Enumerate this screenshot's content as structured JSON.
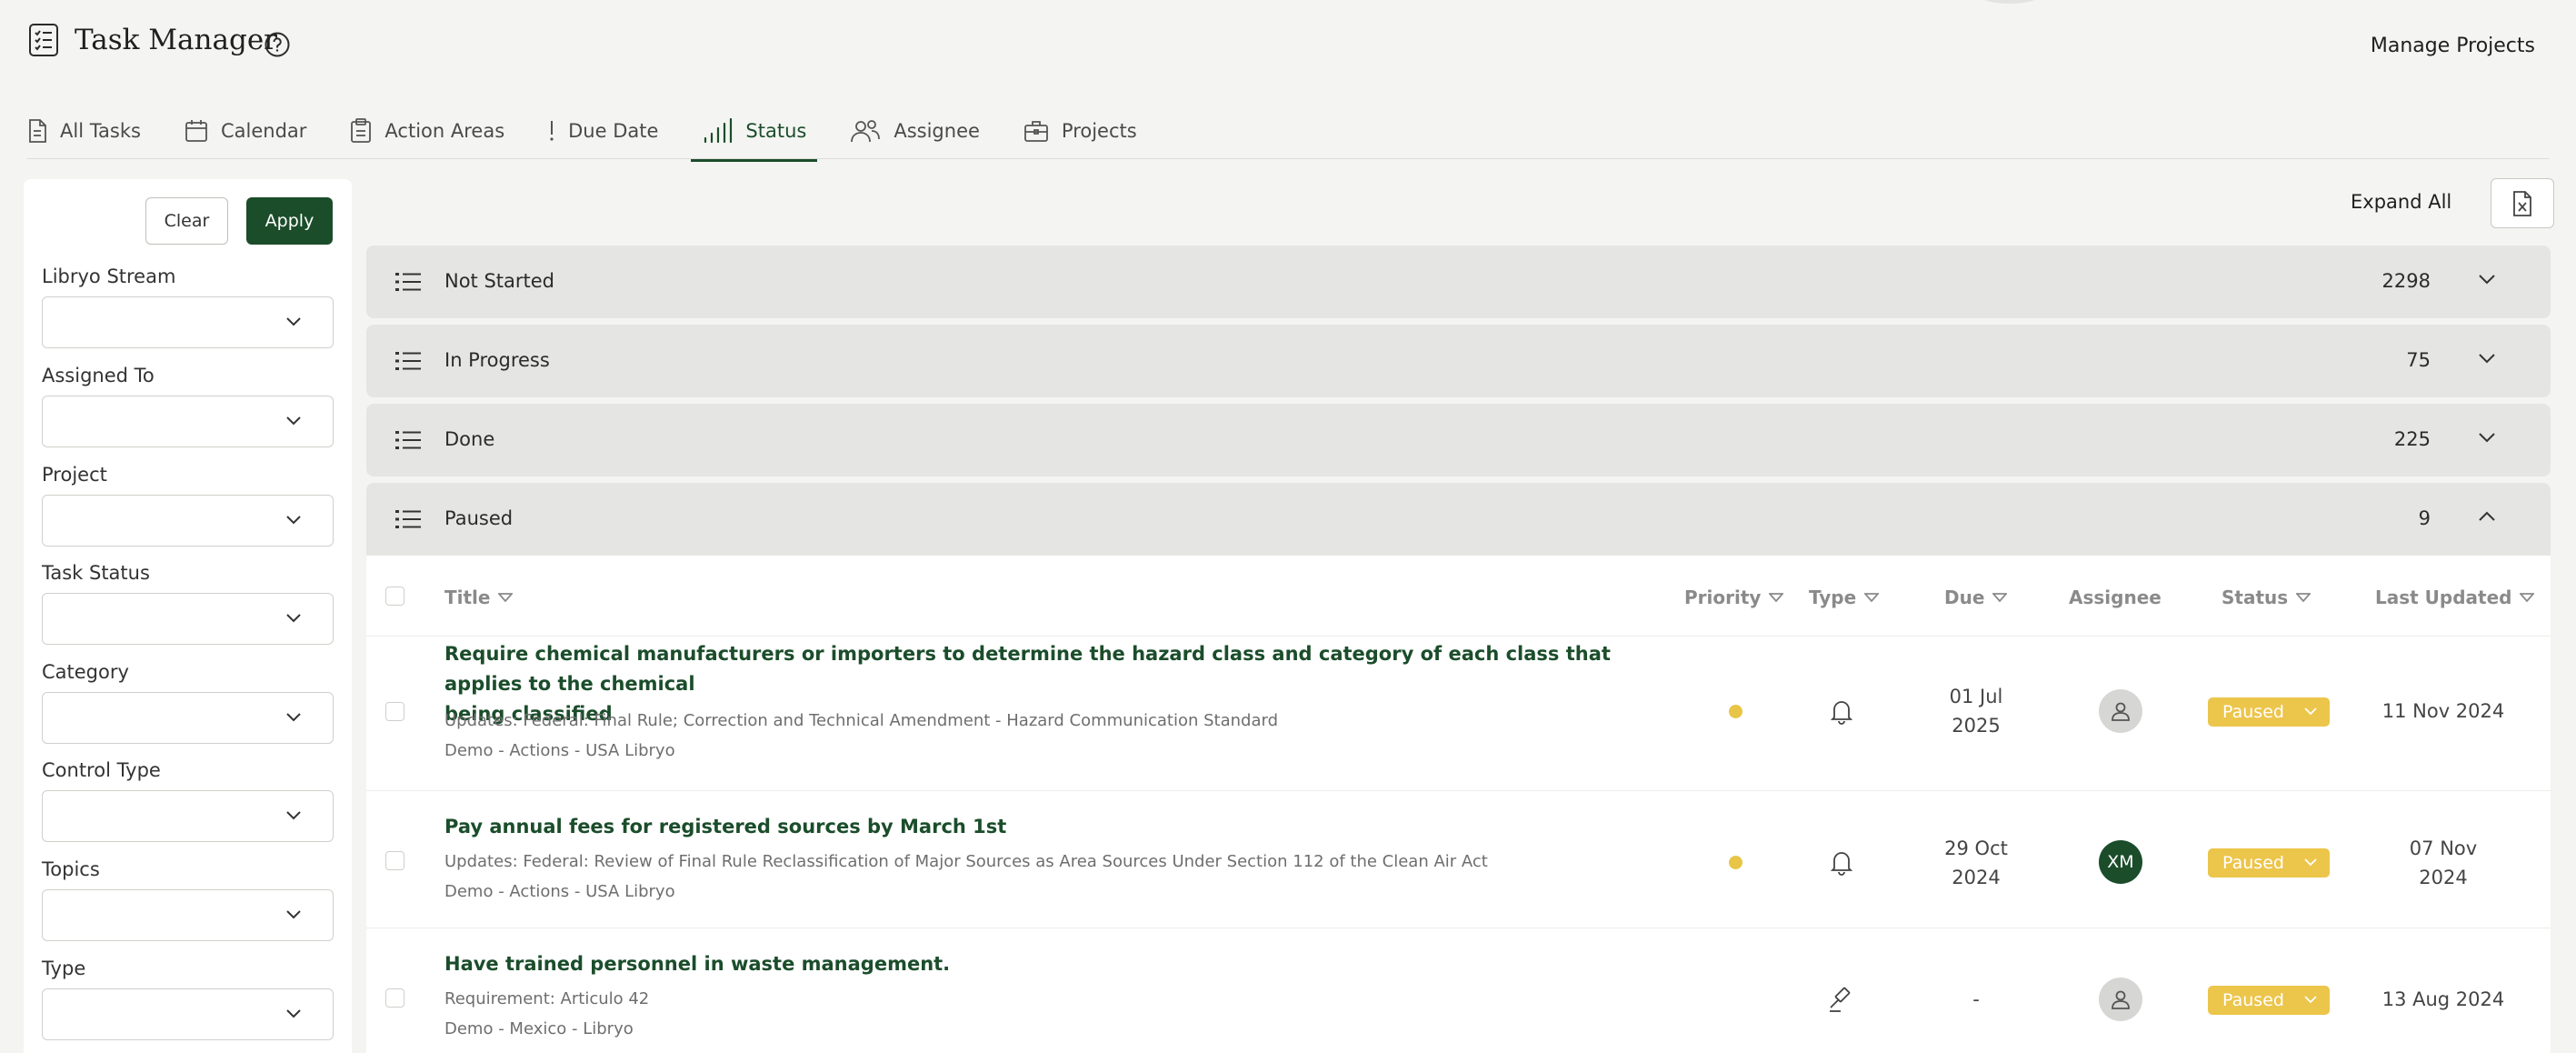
{
  "header": {
    "title": "Task Manager",
    "manage_projects": "Manage Projects"
  },
  "tabs": [
    {
      "label": "All Tasks",
      "icon": "document-icon"
    },
    {
      "label": "Calendar",
      "icon": "calendar-icon"
    },
    {
      "label": "Action Areas",
      "icon": "clipboard-icon"
    },
    {
      "label": "Due Date",
      "icon": "exclamation-icon"
    },
    {
      "label": "Status",
      "icon": "signal-bars-icon",
      "active": true
    },
    {
      "label": "Assignee",
      "icon": "people-icon"
    },
    {
      "label": "Projects",
      "icon": "briefcase-icon"
    }
  ],
  "sidebar": {
    "clear_label": "Clear",
    "apply_label": "Apply",
    "filters": [
      {
        "label": "Libryo Stream"
      },
      {
        "label": "Assigned To"
      },
      {
        "label": "Project"
      },
      {
        "label": "Task Status"
      },
      {
        "label": "Category"
      },
      {
        "label": "Control Type"
      },
      {
        "label": "Topics"
      },
      {
        "label": "Type"
      }
    ]
  },
  "toolbar": {
    "expand_all": "Expand All"
  },
  "groups": [
    {
      "label": "Not Started",
      "count": "2298",
      "expanded": false
    },
    {
      "label": "In Progress",
      "count": "75",
      "expanded": false
    },
    {
      "label": "Done",
      "count": "225",
      "expanded": false
    },
    {
      "label": "Paused",
      "count": "9",
      "expanded": true
    }
  ],
  "table": {
    "columns": {
      "title": "Title",
      "priority": "Priority",
      "type": "Type",
      "due": "Due",
      "assignee": "Assignee",
      "status": "Status",
      "last_updated": "Last Updated"
    },
    "rows": [
      {
        "title_line1": "Require chemical manufacturers or importers to determine the hazard class and category of each class that applies to the chemical",
        "title_line2": "being classified",
        "subtitle": "Updates: Federal: Final Rule; Correction and Technical Amendment - Hazard Communication Standard",
        "stream": "Demo - Actions - USA Libryo",
        "priority": "medium",
        "type_icon": "bell-icon",
        "due_line1": "01 Jul",
        "due_line2": "2025",
        "assignee": "",
        "status": "Paused",
        "updated_line1": "11 Nov 2024",
        "updated_line2": ""
      },
      {
        "title_line1": "Pay annual fees for registered sources by March 1st",
        "title_line2": "",
        "subtitle": "Updates: Federal: Review of Final Rule Reclassification of Major Sources as Area Sources Under Section 112 of the Clean Air Act",
        "stream": "Demo - Actions - USA Libryo",
        "priority": "medium",
        "type_icon": "bell-icon",
        "due_line1": "29 Oct",
        "due_line2": "2024",
        "assignee": "XM",
        "status": "Paused",
        "updated_line1": "07 Nov",
        "updated_line2": "2024"
      },
      {
        "title_line1": "Have trained personnel in waste management.",
        "title_line2": "",
        "subtitle": "Requirement: Articulo 42",
        "stream": "Demo - Mexico - Libryo",
        "priority": "",
        "type_icon": "gavel-icon",
        "due_line1": "-",
        "due_line2": "",
        "assignee": "",
        "status": "Paused",
        "updated_line1": "13 Aug 2024",
        "updated_line2": ""
      }
    ]
  },
  "colors": {
    "brand_green": "#1b4d2b",
    "paused_yellow": "#ecc54b",
    "priority_dot": "#e8c547"
  }
}
